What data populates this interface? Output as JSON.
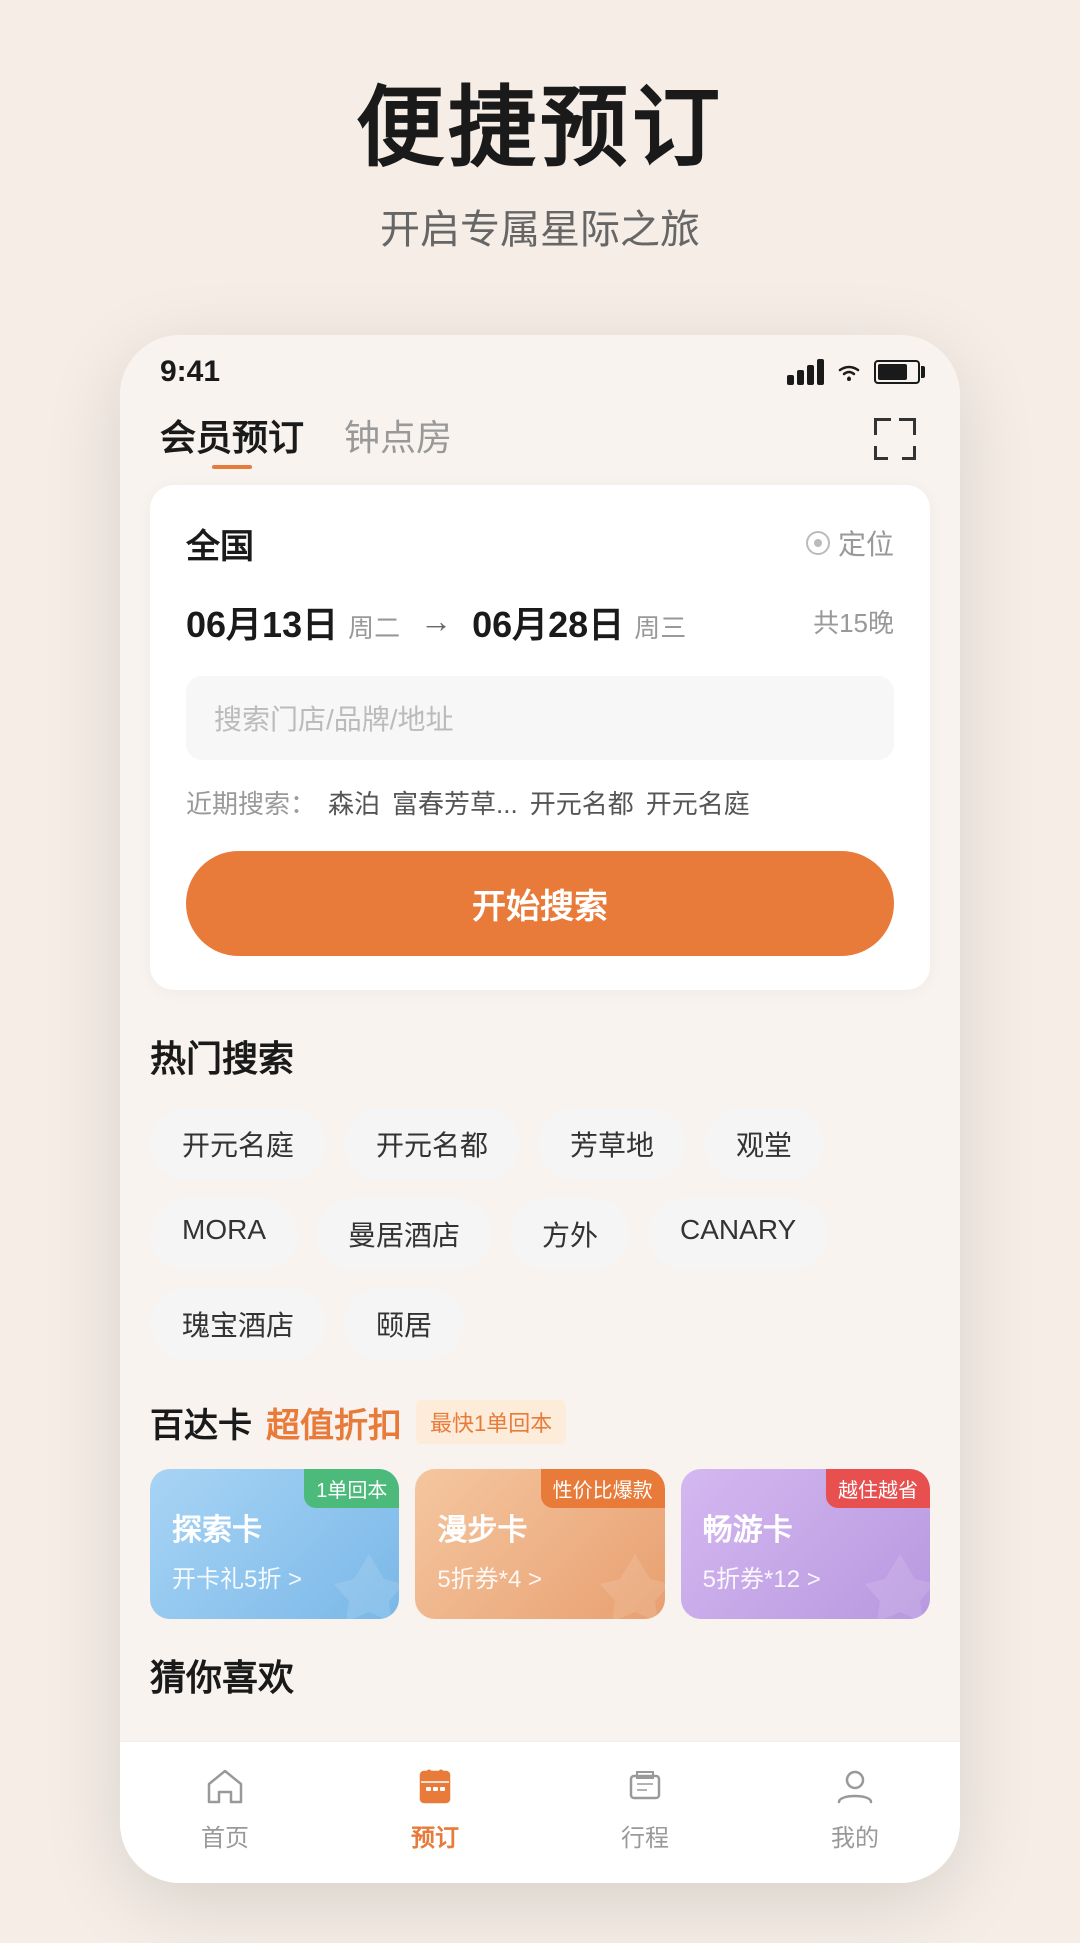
{
  "header": {
    "title": "便捷预订",
    "subtitle": "开启专属星际之旅"
  },
  "statusBar": {
    "time": "9:41"
  },
  "navTabs": {
    "active": "会员预订",
    "inactive": "钟点房"
  },
  "searchCard": {
    "location": "全国",
    "locateLabel": "定位",
    "dateFrom": "06月13日",
    "dateFromWeek": "周二",
    "dateTo": "06月28日",
    "dateToWeek": "周三",
    "nights": "共15晚",
    "searchPlaceholder": "搜索门店/品牌/地址",
    "recentLabel": "近期搜索：",
    "recentItems": [
      "森泊",
      "富春芳草...",
      "开元名都",
      "开元名庭"
    ],
    "searchBtnLabel": "开始搜索"
  },
  "hotSearch": {
    "sectionTitle": "热门搜索",
    "tags": [
      "开元名庭",
      "开元名都",
      "芳草地",
      "观堂",
      "MORA",
      "曼居酒店",
      "方外",
      "CANARY",
      "瑰宝酒店",
      "颐居"
    ]
  },
  "promo": {
    "titleMain": "百达卡",
    "titleHighlight": "超值折扣",
    "badge": "最快1单回本",
    "cards": [
      {
        "badge": "1单回本",
        "badgeType": "badge-green",
        "title": "探索卡",
        "sub": "开卡礼5折 >"
      },
      {
        "badge": "性价比爆款",
        "badgeType": "badge-orange",
        "title": "漫步卡",
        "sub": "5折券*4 >"
      },
      {
        "badge": "越住越省",
        "badgeType": "badge-red",
        "title": "畅游卡",
        "sub": "5折券*12 >"
      }
    ]
  },
  "guessSection": {
    "title": "猜你喜欢"
  },
  "bottomNav": {
    "items": [
      {
        "label": "首页",
        "icon": "home-icon",
        "active": false
      },
      {
        "label": "预订",
        "icon": "booking-icon",
        "active": true
      },
      {
        "label": "行程",
        "icon": "trip-icon",
        "active": false
      },
      {
        "label": "我的",
        "icon": "profile-icon",
        "active": false
      }
    ]
  }
}
